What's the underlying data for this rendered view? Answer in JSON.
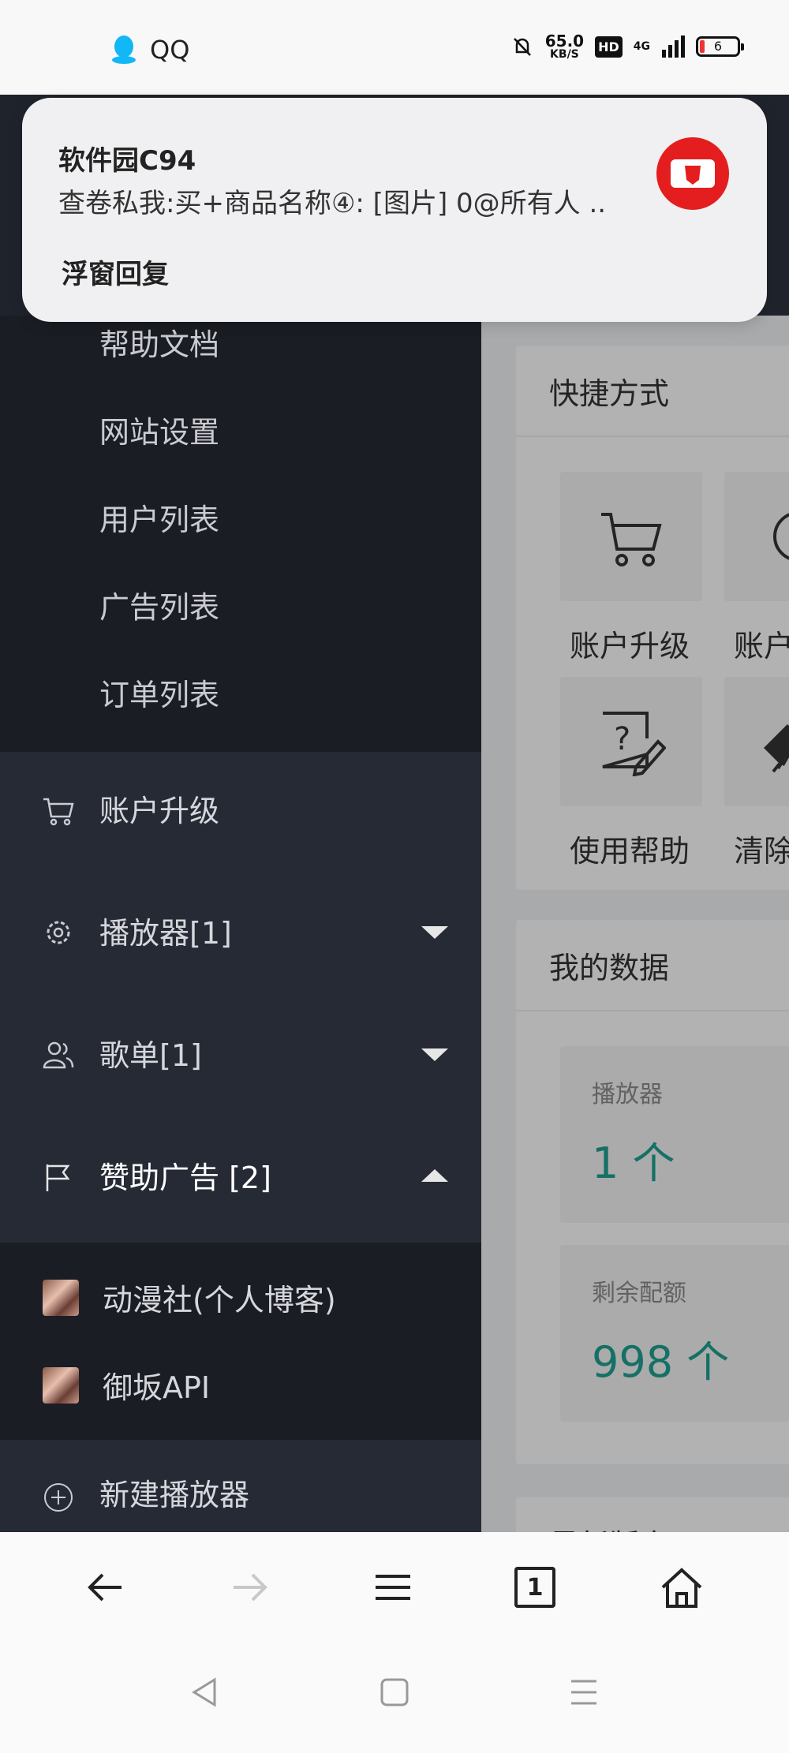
{
  "status_bar": {
    "app_label": "QQ",
    "speed_value": "65.0",
    "speed_unit": "KB/S",
    "hd_badge": "HD",
    "network": "4G",
    "battery": "6"
  },
  "notification": {
    "title": "软件园C94",
    "message": "查卷私我:买+商品名称④: [图片] 0@所有人 ..",
    "reply_action": "浮窗回复"
  },
  "sidebar": {
    "sub_items": [
      "帮助文档",
      "网站设置",
      "用户列表",
      "广告列表",
      "订单列表"
    ],
    "account_upgrade": "账户升级",
    "player": "播放器[1]",
    "playlist": "歌单[1]",
    "sponsor_ads": "赞助广告 [2]",
    "ad_items": [
      "动漫社(个人博客)",
      "御坂API"
    ],
    "new_player": "新建播放器"
  },
  "main": {
    "shortcuts_title": "快捷方式",
    "shortcuts": [
      "账户升级",
      "账户",
      "使用帮助",
      "清除"
    ],
    "my_data_title": "我的数据",
    "stats": [
      {
        "title": "播放器",
        "value": "1 个"
      },
      {
        "title": "剩余配额",
        "value": "998 个"
      }
    ],
    "next_card_title": "最新版本"
  },
  "browser_bar": {
    "tab_count": "1"
  }
}
